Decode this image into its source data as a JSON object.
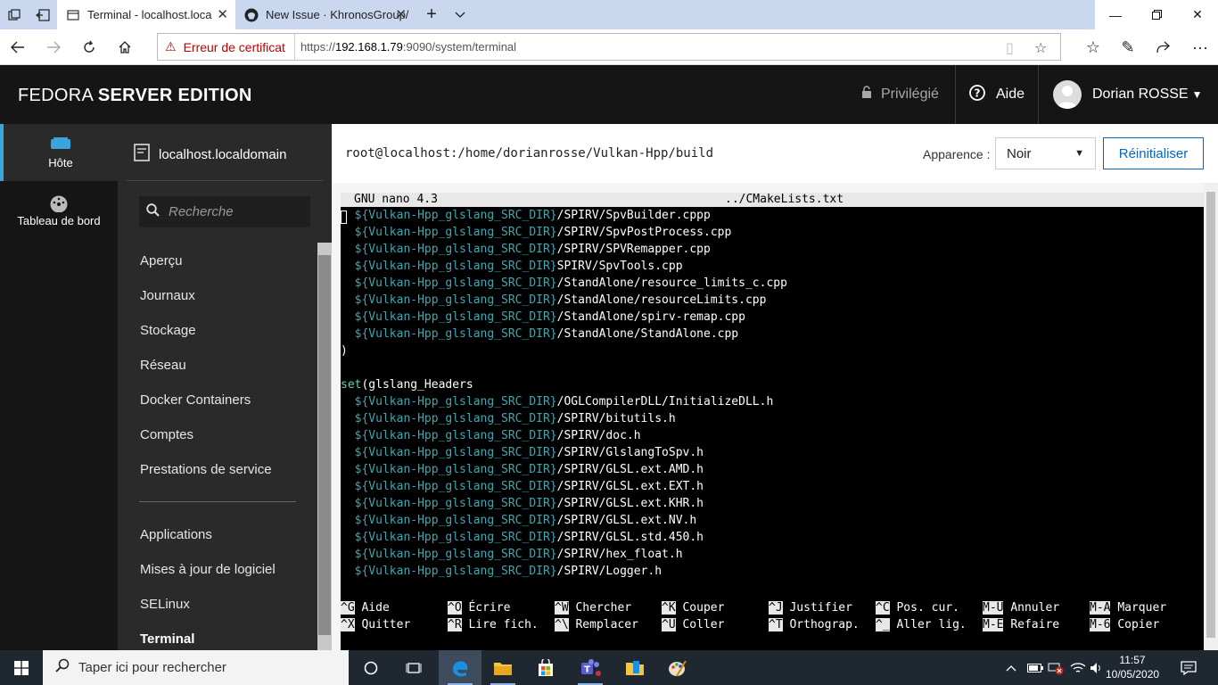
{
  "browser": {
    "tabs": [
      {
        "title": "Terminal - localhost.loca",
        "active": true
      },
      {
        "title": "New Issue · KhronosGroup/",
        "active": false
      }
    ],
    "cert_warning": "Erreur de certificat",
    "url_prefix": "https://",
    "url_host": "192.168.1.79",
    "url_rest": ":9090/system/terminal"
  },
  "header": {
    "brand_light": "FEDORA ",
    "brand_bold": "SERVER EDITION",
    "privileged": "Privilégié",
    "help": "Aide",
    "user": "Dorian ROSSE"
  },
  "leftnav": {
    "host": "Hôte",
    "dashboard": "Tableau de bord"
  },
  "subnav": {
    "hostname": "localhost.localdomain",
    "search_placeholder": "Recherche",
    "items_top": [
      "Aperçu",
      "Journaux",
      "Stockage",
      "Réseau",
      "Docker Containers",
      "Comptes",
      "Prestations de service"
    ],
    "items_bottom": [
      "Applications",
      "Mises à jour de logiciel",
      "SELinux",
      "Terminal"
    ]
  },
  "main": {
    "path": "root@localhost:/home/dorianrosse/Vulkan-Hpp/build",
    "appearance_label": "Apparence :",
    "appearance_value": "Noir",
    "reset_label": "Réinitialiser"
  },
  "terminal": {
    "nano_version": "GNU nano 4.3",
    "file": "../CMakeLists.txt",
    "var": "${Vulkan-Hpp_glslang_SRC_DIR}",
    "lines": [
      {
        "indent": true,
        "var": true,
        "text": "/SPIRV/SpvBuilder.cppp"
      },
      {
        "indent": true,
        "var": true,
        "text": "/SPIRV/SpvPostProcess.cpp"
      },
      {
        "indent": true,
        "var": true,
        "text": "/SPIRV/SPVRemapper.cpp"
      },
      {
        "indent": true,
        "var": true,
        "text": "SPIRV/SpvTools.cpp"
      },
      {
        "indent": true,
        "var": true,
        "text": "/StandAlone/resource_limits_c.cpp"
      },
      {
        "indent": true,
        "var": true,
        "text": "/StandAlone/resourceLimits.cpp"
      },
      {
        "indent": true,
        "var": true,
        "text": "/StandAlone/spirv-remap.cpp"
      },
      {
        "indent": true,
        "var": true,
        "text": "/StandAlone/StandAlone.cpp"
      },
      {
        "indent": false,
        "var": false,
        "text": ")"
      },
      {
        "indent": false,
        "var": false,
        "text": ""
      },
      {
        "indent": false,
        "var": false,
        "kw": "set",
        "text": "(glslang_Headers"
      },
      {
        "indent": true,
        "var": true,
        "text": "/OGLCompilerDLL/InitializeDLL.h"
      },
      {
        "indent": true,
        "var": true,
        "text": "/SPIRV/bitutils.h"
      },
      {
        "indent": true,
        "var": true,
        "text": "/SPIRV/doc.h"
      },
      {
        "indent": true,
        "var": true,
        "text": "/SPIRV/GlslangToSpv.h"
      },
      {
        "indent": true,
        "var": true,
        "text": "/SPIRV/GLSL.ext.AMD.h"
      },
      {
        "indent": true,
        "var": true,
        "text": "/SPIRV/GLSL.ext.EXT.h"
      },
      {
        "indent": true,
        "var": true,
        "text": "/SPIRV/GLSL.ext.KHR.h"
      },
      {
        "indent": true,
        "var": true,
        "text": "/SPIRV/GLSL.ext.NV.h"
      },
      {
        "indent": true,
        "var": true,
        "text": "/SPIRV/GLSL.std.450.h"
      },
      {
        "indent": true,
        "var": true,
        "text": "/SPIRV/hex_float.h"
      },
      {
        "indent": true,
        "var": true,
        "text": "/SPIRV/Logger.h"
      }
    ],
    "shortcuts_row1": [
      {
        "key": "^G",
        "label": "Aide"
      },
      {
        "key": "^O",
        "label": "Écrire"
      },
      {
        "key": "^W",
        "label": "Chercher"
      },
      {
        "key": "^K",
        "label": "Couper"
      },
      {
        "key": "^J",
        "label": "Justifier"
      },
      {
        "key": "^C",
        "label": "Pos. cur."
      },
      {
        "key": "M-U",
        "label": "Annuler"
      },
      {
        "key": "M-A",
        "label": "Marquer"
      }
    ],
    "shortcuts_row2": [
      {
        "key": "^X",
        "label": "Quitter"
      },
      {
        "key": "^R",
        "label": "Lire fich."
      },
      {
        "key": "^\\",
        "label": "Remplacer"
      },
      {
        "key": "^U",
        "label": "Coller"
      },
      {
        "key": "^T",
        "label": "Orthograp."
      },
      {
        "key": "^_",
        "label": "Aller lig."
      },
      {
        "key": "M-E",
        "label": "Refaire"
      },
      {
        "key": "M-6",
        "label": "Copier"
      }
    ]
  },
  "taskbar": {
    "search_placeholder": "Taper ici pour rechercher",
    "time": "11:57",
    "date": "10/05/2020"
  }
}
